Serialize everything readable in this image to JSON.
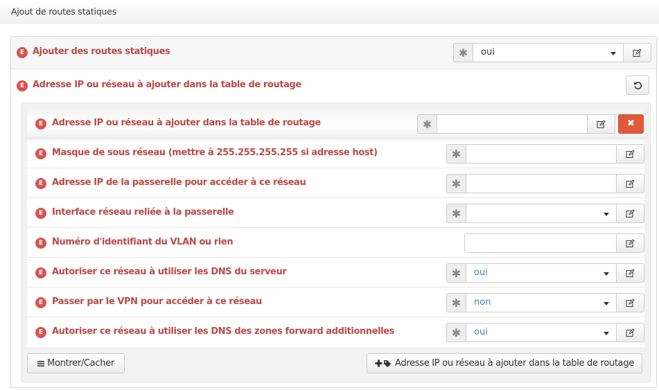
{
  "header": {
    "title": "Ajout de routes statiques"
  },
  "main_rows": {
    "ajouter": {
      "badge": "E",
      "label": "Ajouter des routes statiques",
      "value": "oui"
    },
    "adresse_group": {
      "badge": "E",
      "label": "Adresse IP ou réseau à ajouter dans la table de routage"
    }
  },
  "sub_fields": [
    {
      "badge": "E",
      "label": "Adresse IP ou réseau à ajouter dans la table de routage",
      "value": ""
    },
    {
      "badge": "E",
      "label": "Masque de sous réseau (mettre à 255.255.255.255 si adresse host)",
      "value": ""
    },
    {
      "badge": "E",
      "label": "Adresse IP de la passerelle pour accéder à ce réseau",
      "value": ""
    },
    {
      "badge": "E",
      "label": "Interface réseau reliée à la passerelle",
      "value": ""
    },
    {
      "badge": "E",
      "label": "Numéro d'identifiant du VLAN ou rien",
      "value": ""
    },
    {
      "badge": "E",
      "label": "Autoriser ce réseau à utiliser les DNS du serveur",
      "value": "oui"
    },
    {
      "badge": "E",
      "label": "Passer par le VPN pour accéder à ce réseau",
      "value": "non"
    },
    {
      "badge": "E",
      "label": "Autoriser ce réseau à utiliser les DNS des zones forward additionnelles",
      "value": "oui"
    }
  ],
  "addon": {
    "required_symbol": "✱",
    "delete_symbol": "✖"
  },
  "footer": {
    "toggle_label": "Montrer/Cacher",
    "add_label": "Adresse IP ou réseau à ajouter dans la table de routage"
  },
  "colors": {
    "label_red": "#b94a48",
    "badge_red": "#d9534f",
    "delete_orange": "#e1593a",
    "value_blue": "#3a87ad"
  },
  "icons": {
    "edit": "pencil-square-icon",
    "reset": "rotate-icon",
    "add": "plus-icon",
    "tag": "tag-icon",
    "menu": "bars-icon"
  }
}
